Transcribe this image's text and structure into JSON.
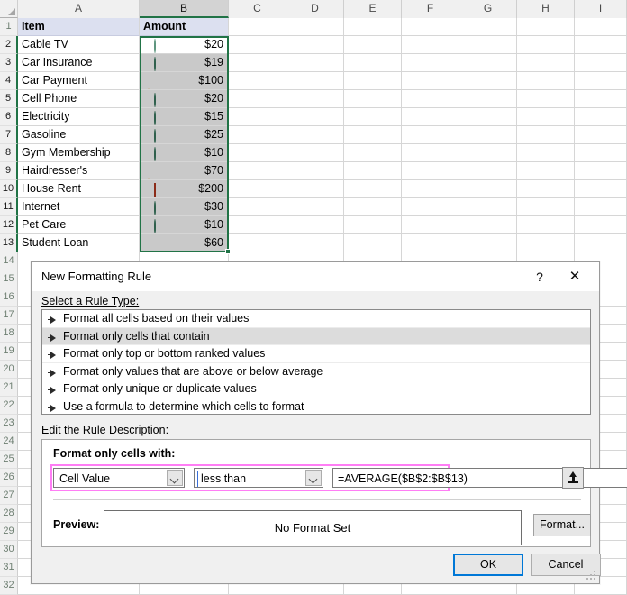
{
  "spreadsheet": {
    "column_headers": [
      "A",
      "B",
      "C",
      "D",
      "E",
      "F",
      "G",
      "H",
      "I"
    ],
    "selected_column": "B",
    "row_headers": [
      1,
      2,
      3,
      4,
      5,
      6,
      7,
      8,
      9,
      10,
      11,
      12,
      13,
      14,
      15,
      16,
      17,
      18,
      19,
      20,
      21,
      22,
      23,
      24,
      25,
      26,
      27,
      28,
      29,
      30,
      31,
      32
    ],
    "selected_rows": [
      2,
      3,
      4,
      5,
      6,
      7,
      8,
      9,
      10,
      11,
      12,
      13
    ],
    "header_row": {
      "item": "Item",
      "amount": "Amount"
    },
    "selection_range": "B2:B13",
    "active_cell": "B2",
    "rows": [
      {
        "row": 2,
        "item": "Cable TV",
        "amount": "$20",
        "icon": "circle-green-light"
      },
      {
        "row": 3,
        "item": "Car Insurance",
        "amount": "$19",
        "icon": "circle-green"
      },
      {
        "row": 4,
        "item": "Car Payment",
        "amount": "$100",
        "icon": "triangle-yellow"
      },
      {
        "row": 5,
        "item": "Cell Phone",
        "amount": "$20",
        "icon": "circle-green"
      },
      {
        "row": 6,
        "item": "Electricity",
        "amount": "$15",
        "icon": "circle-green"
      },
      {
        "row": 7,
        "item": "Gasoline",
        "amount": "$25",
        "icon": "circle-green"
      },
      {
        "row": 8,
        "item": "Gym Membership",
        "amount": "$10",
        "icon": "circle-green"
      },
      {
        "row": 9,
        "item": "Hairdresser's",
        "amount": "$70",
        "icon": "triangle-yellow"
      },
      {
        "row": 10,
        "item": "House Rent",
        "amount": "$200",
        "icon": "diamond-red"
      },
      {
        "row": 11,
        "item": "Internet",
        "amount": "$30",
        "icon": "circle-green"
      },
      {
        "row": 12,
        "item": "Pet Care",
        "amount": "$10",
        "icon": "circle-green"
      },
      {
        "row": 13,
        "item": "Student Loan",
        "amount": "$60",
        "icon": "triangle-yellow"
      }
    ],
    "colors": {
      "selection_border": "#217346",
      "selected_fill": "#c9c9c9",
      "header_fill": "#dce0f0",
      "icon_green": "#3f7d64",
      "icon_green_light": "#7fb59b",
      "icon_yellow": "#c5a871",
      "icon_red": "#b03a22"
    }
  },
  "dialog": {
    "title": "New Formatting Rule",
    "help_label": "?",
    "close_label": "✕",
    "rule_type_label": "Select a Rule Type:",
    "rule_types": [
      {
        "label": "Format all cells based on their values",
        "selected": false
      },
      {
        "label": "Format only cells that contain",
        "selected": true
      },
      {
        "label": "Format only top or bottom ranked values",
        "selected": false
      },
      {
        "label": "Format only values that are above or below average",
        "selected": false
      },
      {
        "label": "Format only unique or duplicate values",
        "selected": false
      },
      {
        "label": "Use a formula to determine which cells to format",
        "selected": false
      }
    ],
    "edit_description_label": "Edit the Rule Description:",
    "format_only_cells_label": "Format only cells with:",
    "condition": {
      "type_value": "Cell Value",
      "operator_value": "less than",
      "formula_value": "=AVERAGE($B$2:$B$13)",
      "range_selector_icon": "collapse-dialog-icon",
      "highlight_color": "#ff7ef5"
    },
    "preview_label": "Preview:",
    "preview_text": "No Format Set",
    "format_button_label": "Format...",
    "ok_button_label": "OK",
    "cancel_button_label": "Cancel",
    "ok_focus_color": "#0078d7"
  }
}
